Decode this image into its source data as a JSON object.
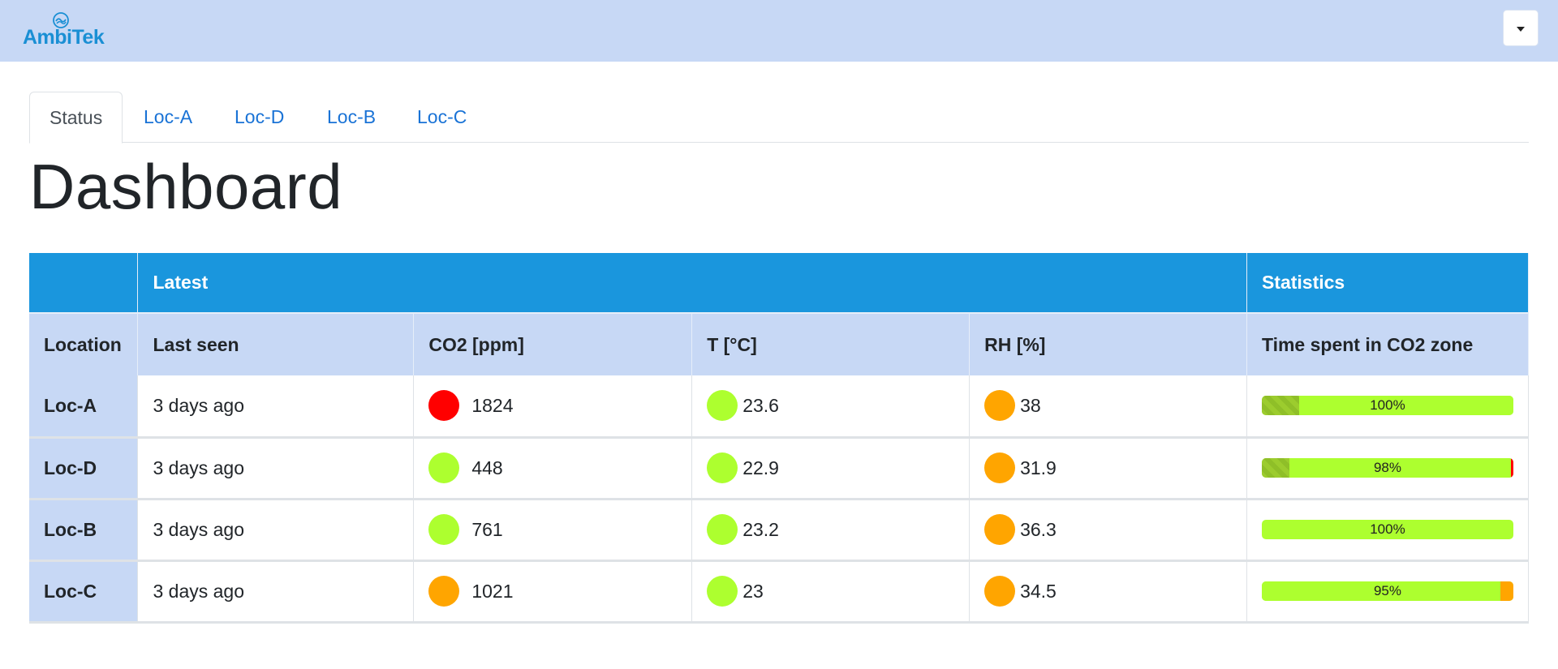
{
  "brand": {
    "name": "AmbiTek",
    "logo_icon": "ambitek-logo-icon",
    "color": "#1a8fd4"
  },
  "navbar": {
    "background": "#c7d8f5",
    "menu_icon": "caret-down-icon"
  },
  "tabs": [
    {
      "label": "Status",
      "active": true
    },
    {
      "label": "Loc-A",
      "active": false
    },
    {
      "label": "Loc-D",
      "active": false
    },
    {
      "label": "Loc-B",
      "active": false
    },
    {
      "label": "Loc-C",
      "active": false
    }
  ],
  "page_title": "Dashboard",
  "table": {
    "groups": {
      "latest": "Latest",
      "statistics": "Statistics"
    },
    "columns": [
      "Location",
      "Last seen",
      "CO2 [ppm]",
      "T [°C]",
      "RH [%]",
      "Time spent in CO2 zone"
    ],
    "rows": [
      {
        "location": "Loc-A",
        "last_seen": "3 days ago",
        "co2": "1824",
        "co2_status": "#ff0000",
        "temp": "23.6",
        "temp_status": "#adff2f",
        "rh": "38",
        "rh_status": "#ffa500",
        "zone_pct": "100%",
        "zone_stripe": 0.15,
        "zone_green": 0.85,
        "zone_orange": 0,
        "zone_red": 0
      },
      {
        "location": "Loc-D",
        "last_seen": "3 days ago",
        "co2": "448",
        "co2_status": "#adff2f",
        "temp": "22.9",
        "temp_status": "#adff2f",
        "rh": "31.9",
        "rh_status": "#ffa500",
        "zone_pct": "98%",
        "zone_stripe": 0.11,
        "zone_green": 0.88,
        "zone_orange": 0,
        "zone_red": 0.01
      },
      {
        "location": "Loc-B",
        "last_seen": "3 days ago",
        "co2": "761",
        "co2_status": "#adff2f",
        "temp": "23.2",
        "temp_status": "#adff2f",
        "rh": "36.3",
        "rh_status": "#ffa500",
        "zone_pct": "100%",
        "zone_stripe": 0,
        "zone_green": 1.0,
        "zone_orange": 0,
        "zone_red": 0
      },
      {
        "location": "Loc-C",
        "last_seen": "3 days ago",
        "co2": "1021",
        "co2_status": "#ffa500",
        "temp": "23",
        "temp_status": "#adff2f",
        "rh": "34.5",
        "rh_status": "#ffa500",
        "zone_pct": "95%",
        "zone_stripe": 0,
        "zone_green": 0.95,
        "zone_orange": 0.05,
        "zone_red": 0
      }
    ]
  },
  "colors": {
    "header_blue": "#1a96dd",
    "header_light": "#c7d8f5",
    "good": "#adff2f",
    "warn": "#ffa500",
    "bad": "#ff0000",
    "link": "#1a73d6"
  }
}
